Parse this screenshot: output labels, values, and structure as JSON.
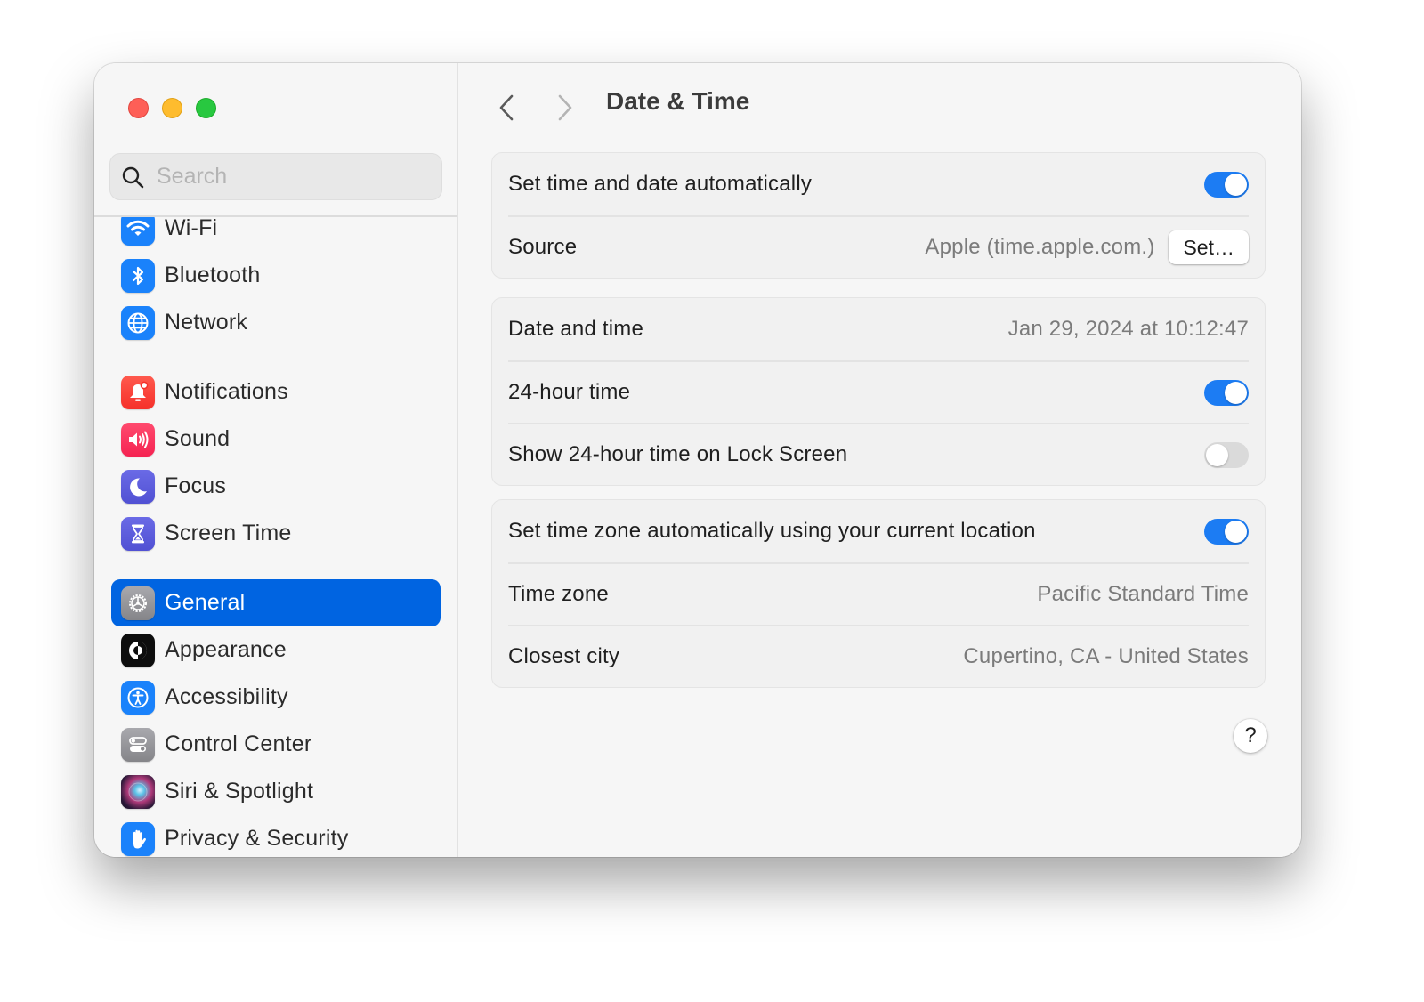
{
  "window": {
    "title": "Date & Time",
    "traffic_lights": [
      "close",
      "minimize",
      "maximize"
    ]
  },
  "sidebar": {
    "search": {
      "placeholder": "Search",
      "value": "",
      "icon": "magnifying-glass-icon"
    },
    "items": [
      {
        "id": "wifi",
        "label": "Wi-Fi",
        "icon": "wifi-icon",
        "color": "#1a82fb",
        "selected": false
      },
      {
        "id": "bluetooth",
        "label": "Bluetooth",
        "icon": "bluetooth-icon",
        "color": "#1a82fb",
        "selected": false
      },
      {
        "id": "network",
        "label": "Network",
        "icon": "globe-icon",
        "color": "#1a82fb",
        "selected": false
      },
      {
        "id": "notifications",
        "label": "Notifications",
        "icon": "bell-icon",
        "color": "#fb3b30",
        "selected": false
      },
      {
        "id": "sound",
        "label": "Sound",
        "icon": "speaker-icon",
        "color": "#fb2d55",
        "selected": false
      },
      {
        "id": "focus",
        "label": "Focus",
        "icon": "moon-icon",
        "color": "#5b5bdc",
        "selected": false
      },
      {
        "id": "screen-time",
        "label": "Screen Time",
        "icon": "hourglass-icon",
        "color": "#5b5bdc",
        "selected": false
      },
      {
        "id": "general",
        "label": "General",
        "icon": "gear-icon",
        "color": "#8e8e93",
        "selected": true
      },
      {
        "id": "appearance",
        "label": "Appearance",
        "icon": "appearance-icon",
        "color": "#111111",
        "selected": false
      },
      {
        "id": "accessibility",
        "label": "Accessibility",
        "icon": "accessibility-icon",
        "color": "#1a82fb",
        "selected": false
      },
      {
        "id": "control-center",
        "label": "Control Center",
        "icon": "switches-icon",
        "color": "#8e8e93",
        "selected": false
      },
      {
        "id": "siri-spotlight",
        "label": "Siri & Spotlight",
        "icon": "siri-icon",
        "color": "#2a2040",
        "selected": false
      },
      {
        "id": "privacy-security",
        "label": "Privacy & Security",
        "icon": "hand-icon",
        "color": "#1a82fb",
        "selected": false
      }
    ]
  },
  "toolbar": {
    "back_icon": "chevron-left-icon",
    "forward_icon": "chevron-right-icon",
    "title": "Date & Time"
  },
  "groups": [
    {
      "rows": [
        {
          "label": "Set time and date automatically",
          "control": "toggle",
          "on": true
        },
        {
          "label": "Source",
          "value": "Apple (time.apple.com.)",
          "button": "Set…"
        }
      ]
    },
    {
      "rows": [
        {
          "label": "Date and time",
          "value": "Jan 29, 2024 at 10:12:47"
        },
        {
          "label": "24-hour time",
          "control": "toggle",
          "on": true
        },
        {
          "label": "Show 24-hour time on Lock Screen",
          "control": "toggle",
          "on": false
        }
      ]
    },
    {
      "rows": [
        {
          "label": "Set time zone automatically using your current location",
          "control": "toggle",
          "on": true
        },
        {
          "label": "Time zone",
          "value": "Pacific Standard Time"
        },
        {
          "label": "Closest city",
          "value": "Cupertino, CA - United States"
        }
      ]
    }
  ],
  "help_button": {
    "label": "?"
  },
  "colors": {
    "accent": "#0064e1",
    "toggle_on": "#1c7cf3",
    "toggle_off": "#dadada"
  }
}
